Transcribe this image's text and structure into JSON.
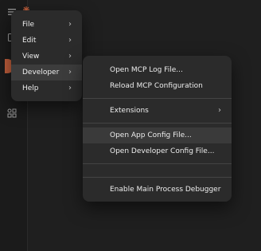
{
  "icons": {
    "hamburger": "hamburger-menu-icon",
    "logo": "claude-logo-icon",
    "square": "new-chat-icon",
    "apps": "apps-grid-icon"
  },
  "menu": {
    "items": [
      {
        "label": "File"
      },
      {
        "label": "Edit"
      },
      {
        "label": "View"
      },
      {
        "label": "Developer"
      },
      {
        "label": "Help"
      }
    ]
  },
  "developer_menu": {
    "open_log": "Open MCP Log File...",
    "reload_config": "Reload MCP Configuration",
    "extensions": "Extensions",
    "open_app_config": "Open App Config File...",
    "open_dev_config": "Open Developer Config File...",
    "enable_debugger": "Enable Main Process Debugger"
  },
  "colors": {
    "accent": "#c15f3c",
    "menu_bg": "#2b2b2b",
    "app_bg": "#1f1f1f"
  }
}
